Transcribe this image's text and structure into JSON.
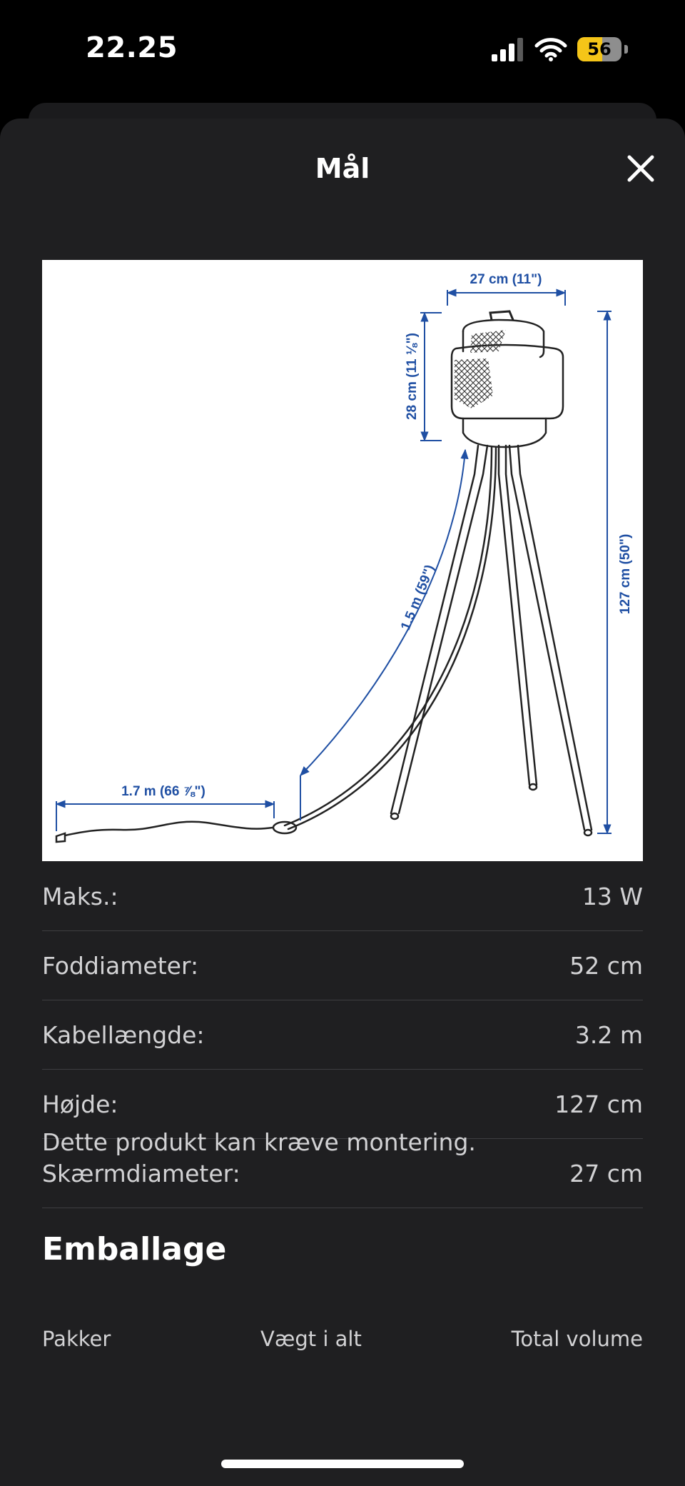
{
  "status_bar": {
    "time": "22.25",
    "battery_level": "56",
    "battery_fraction": 0.56,
    "signal_bars": 3,
    "icons": [
      "cellular-signal-icon",
      "wifi-icon",
      "battery-icon"
    ]
  },
  "sheet": {
    "title": "Mål",
    "close_icon": "close-icon"
  },
  "diagram": {
    "shade_width_label": "27 cm (11\")",
    "shade_height_label": "28 cm (11 ⅛\")",
    "total_height_label": "127 cm (50\")",
    "upper_cable_label": "1.5 m (59\")",
    "lower_cable_label": "1.7 m (66 ⅞\")",
    "dimension_color": "#1f4fa3"
  },
  "specs": [
    {
      "label": "Maks.:",
      "value": "13 W"
    },
    {
      "label": "Foddiameter:",
      "value": "52 cm"
    },
    {
      "label": "Kabellængde:",
      "value": "3.2 m"
    },
    {
      "label": "Højde:",
      "value": "127 cm"
    },
    {
      "label": "Skærmdiameter:",
      "value": "27 cm"
    }
  ],
  "note": "Dette produkt kan kræve montering.",
  "packaging": {
    "title": "Emballage",
    "columns": [
      "Pakker",
      "Vægt i alt",
      "Total volume"
    ]
  },
  "colors": {
    "background": "#000000",
    "sheet": "#1f1f21",
    "divider": "#3e3e41",
    "text_secondary": "#d2d2d4",
    "battery": "#f5c518"
  }
}
